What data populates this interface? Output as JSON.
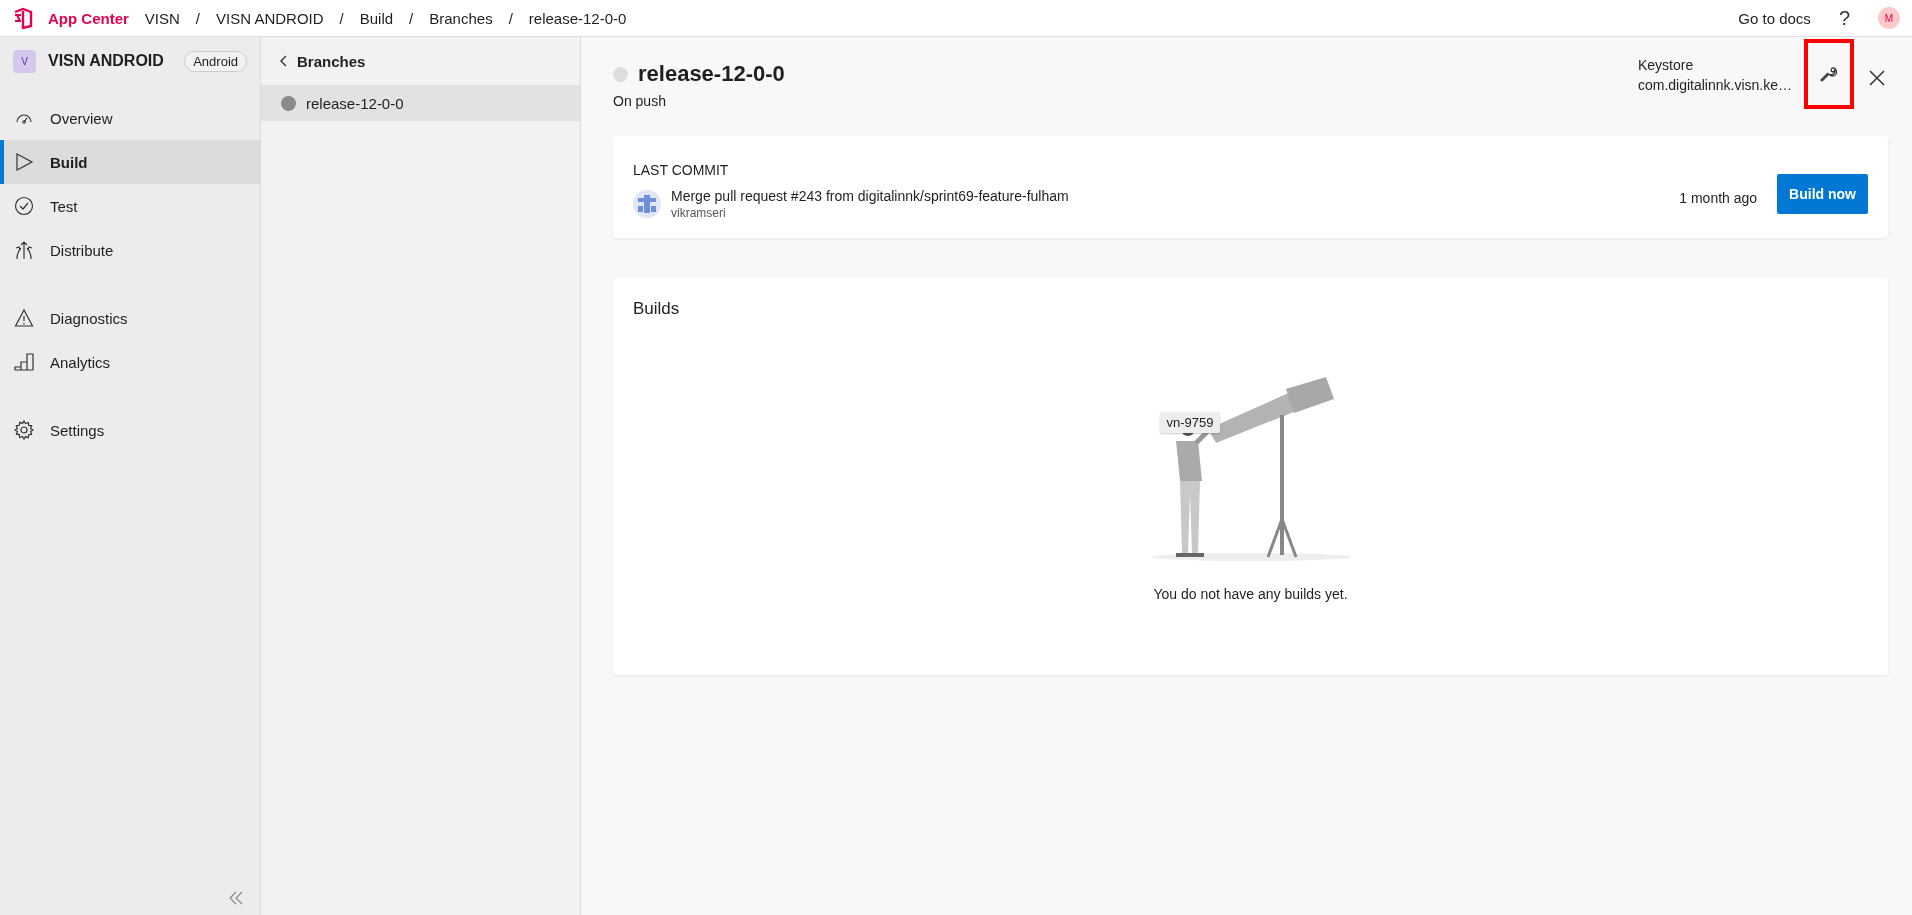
{
  "top_bar": {
    "brand": "App Center",
    "breadcrumb_separator": "/",
    "breadcrumbs": [
      "VISN",
      "VISN ANDROID",
      "Build",
      "Branches",
      "release-12-0-0"
    ],
    "docs_link": "Go to docs",
    "help": "?",
    "avatar": "M"
  },
  "sidebar": {
    "app_initial": "V",
    "app_name": "VISN ANDROID",
    "platform": "Android",
    "groups": [
      [
        {
          "label": "Overview",
          "selected": false
        },
        {
          "label": "Build",
          "selected": true
        },
        {
          "label": "Test",
          "selected": false
        },
        {
          "label": "Distribute",
          "selected": false
        }
      ],
      [
        {
          "label": "Diagnostics",
          "selected": false
        },
        {
          "label": "Analytics",
          "selected": false
        }
      ],
      [
        {
          "label": "Settings",
          "selected": false
        }
      ]
    ]
  },
  "branches": {
    "title": "Branches",
    "items": [
      {
        "name": "release-12-0-0",
        "selected": true
      }
    ]
  },
  "branch_detail": {
    "title": "release-12-0-0",
    "trigger": "On push",
    "keystore_label": "Keystore",
    "keystore_value": "com.digitalinnk.visn.ke…",
    "configure_highlighted": true,
    "last_commit": {
      "heading": "LAST COMMIT",
      "message": "Merge pull request #243 from digitalinnk/sprint69-feature-fulham",
      "author": "vikramseri",
      "time": "1 month ago",
      "button": "Build now"
    },
    "builds": {
      "title": "Builds",
      "tooltip": "vn-9759",
      "empty_text": "You do not have any builds yet."
    }
  }
}
